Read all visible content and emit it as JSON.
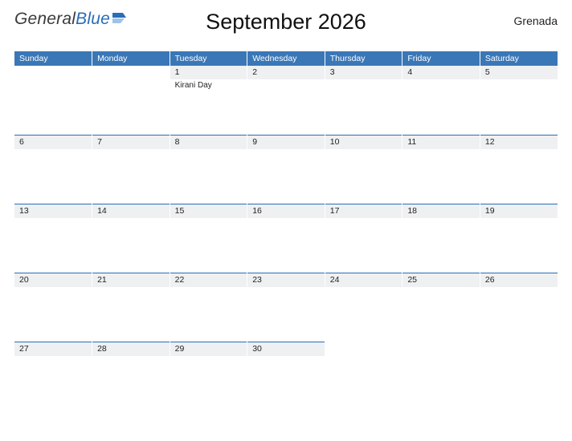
{
  "logo": {
    "part1": "General",
    "part2": "Blue"
  },
  "title": "September 2026",
  "region": "Grenada",
  "dayHeaders": [
    "Sunday",
    "Monday",
    "Tuesday",
    "Wednesday",
    "Thursday",
    "Friday",
    "Saturday"
  ],
  "weeks": [
    [
      {
        "n": "",
        "event": ""
      },
      {
        "n": "",
        "event": ""
      },
      {
        "n": "1",
        "event": "Kirani Day"
      },
      {
        "n": "2",
        "event": ""
      },
      {
        "n": "3",
        "event": ""
      },
      {
        "n": "4",
        "event": ""
      },
      {
        "n": "5",
        "event": ""
      }
    ],
    [
      {
        "n": "6",
        "event": ""
      },
      {
        "n": "7",
        "event": ""
      },
      {
        "n": "8",
        "event": ""
      },
      {
        "n": "9",
        "event": ""
      },
      {
        "n": "10",
        "event": ""
      },
      {
        "n": "11",
        "event": ""
      },
      {
        "n": "12",
        "event": ""
      }
    ],
    [
      {
        "n": "13",
        "event": ""
      },
      {
        "n": "14",
        "event": ""
      },
      {
        "n": "15",
        "event": ""
      },
      {
        "n": "16",
        "event": ""
      },
      {
        "n": "17",
        "event": ""
      },
      {
        "n": "18",
        "event": ""
      },
      {
        "n": "19",
        "event": ""
      }
    ],
    [
      {
        "n": "20",
        "event": ""
      },
      {
        "n": "21",
        "event": ""
      },
      {
        "n": "22",
        "event": ""
      },
      {
        "n": "23",
        "event": ""
      },
      {
        "n": "24",
        "event": ""
      },
      {
        "n": "25",
        "event": ""
      },
      {
        "n": "26",
        "event": ""
      }
    ],
    [
      {
        "n": "27",
        "event": ""
      },
      {
        "n": "28",
        "event": ""
      },
      {
        "n": "29",
        "event": ""
      },
      {
        "n": "30",
        "event": ""
      },
      {
        "n": "",
        "event": ""
      },
      {
        "n": "",
        "event": ""
      },
      {
        "n": "",
        "event": ""
      }
    ]
  ]
}
